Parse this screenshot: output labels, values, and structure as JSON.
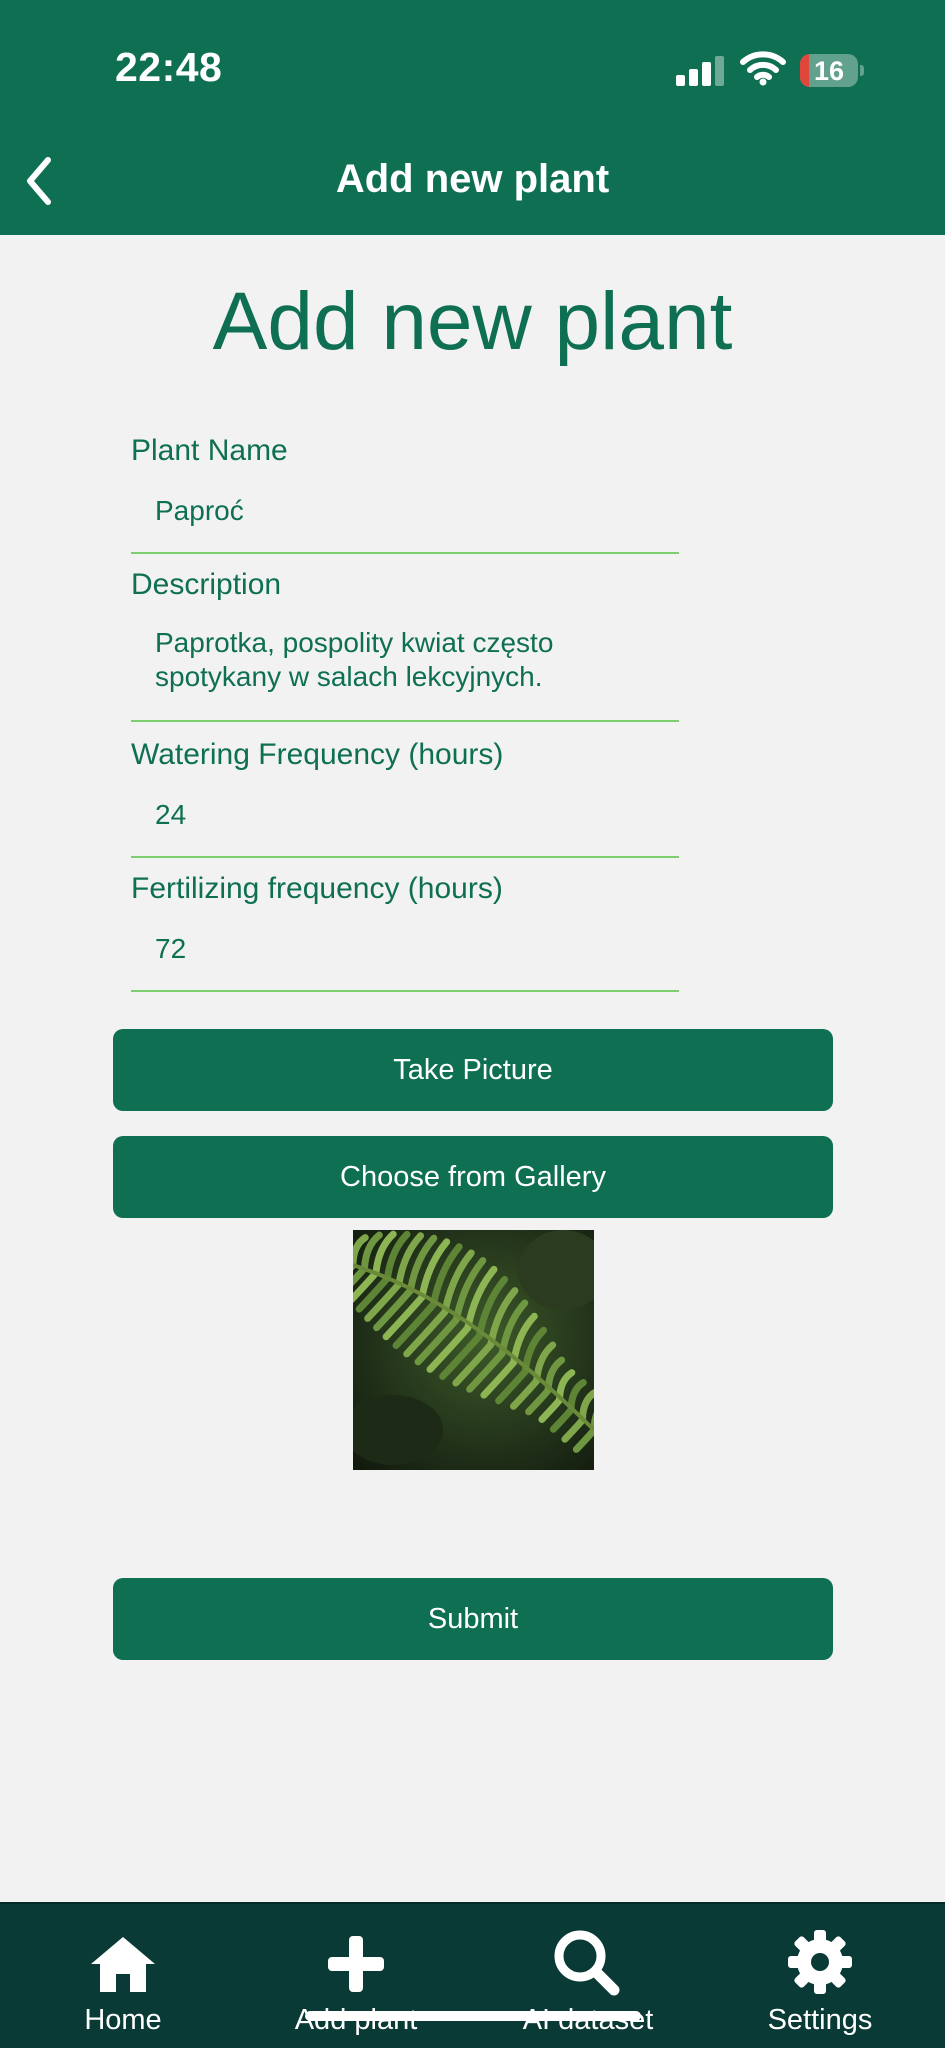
{
  "status_bar": {
    "time": "22:48",
    "battery_level": "16",
    "battery_fraction": 0.16,
    "icons": [
      "cellular-signal-icon",
      "wifi-icon",
      "battery-icon"
    ]
  },
  "nav": {
    "title": "Add new plant",
    "back_icon": "chevron-left-icon"
  },
  "page": {
    "heading": "Add new plant"
  },
  "form": {
    "fields": [
      {
        "label": "Plant Name",
        "value": "Paproć"
      },
      {
        "label": "Description",
        "value": "Paprotka, pospolity kwiat często\nspotykany w salach lekcyjnych."
      },
      {
        "label": "Watering Frequency (hours)",
        "value": "24"
      },
      {
        "label": "Fertilizing frequency (hours)",
        "value": "72"
      }
    ],
    "take_picture_label": "Take Picture",
    "gallery_label": "Choose from Gallery",
    "submit_label": "Submit",
    "photo_subject": "fern-photo"
  },
  "tabbar": {
    "items": [
      {
        "label": "Home",
        "icon": "home-icon"
      },
      {
        "label": "Add plant",
        "icon": "plus-icon"
      },
      {
        "label": "AI dataset",
        "icon": "search-icon"
      },
      {
        "label": "Settings",
        "icon": "gear-icon"
      }
    ]
  },
  "colors": {
    "brand_green": "#0e6f52",
    "tabbar_bg": "#093a35",
    "underline": "#7ccf6d",
    "background": "#f2f2f2"
  }
}
